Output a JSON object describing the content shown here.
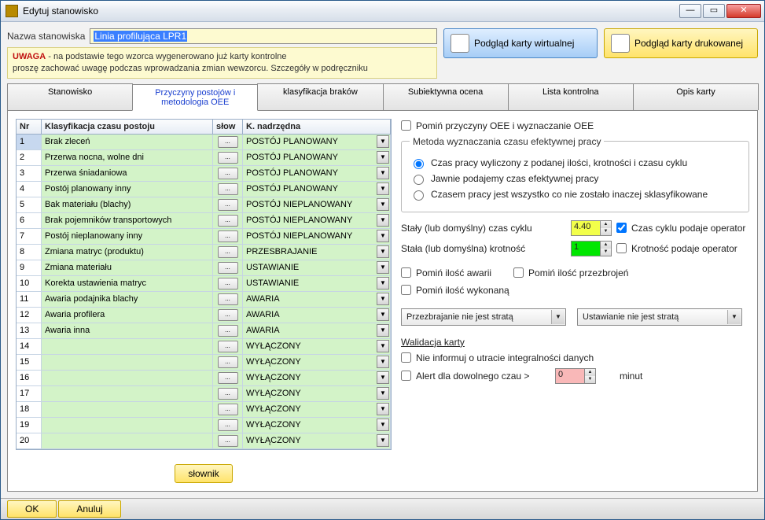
{
  "window": {
    "title": "Edytuj stanowisko"
  },
  "header": {
    "name_label": "Nazwa stanowiska",
    "name_value": "Linia profilująca LPR1",
    "warning_bold": "UWAGA",
    "warning_text": " - na podstawie tego wzorca wygenerowano już karty kontrolne\nproszę zachować uwagę podczas wprowadzania zmian wewzorcu. Szczegóły w podręczniku",
    "btn_virtual": "Podgląd karty wirtualnej",
    "btn_print": "Podgląd karty drukowanej"
  },
  "tabs": [
    "Stanowisko",
    "Przyczyny postojów i metodologia OEE",
    "klasyfikacja braków",
    "Subiektywna ocena",
    "Lista kontrolna",
    "Opis karty"
  ],
  "active_tab": 1,
  "grid": {
    "headers": {
      "nr": "Nr",
      "klas": "Klasyfikacja czasu postoju",
      "slow": "słow",
      "knad": "K. nadrzędna"
    },
    "rows": [
      {
        "nr": "1",
        "klas": "Brak zleceń",
        "knad": "POSTÓJ PLANOWANY"
      },
      {
        "nr": "2",
        "klas": "Przerwa nocna, wolne dni",
        "knad": "POSTÓJ PLANOWANY"
      },
      {
        "nr": "3",
        "klas": "Przerwa śniadaniowa",
        "knad": "POSTÓJ PLANOWANY"
      },
      {
        "nr": "4",
        "klas": "Postój planowany inny",
        "knad": "POSTÓJ PLANOWANY"
      },
      {
        "nr": "5",
        "klas": "Bak materiału (blachy)",
        "knad": "POSTÓJ NIEPLANOWANY"
      },
      {
        "nr": "6",
        "klas": "Brak pojemników transportowych",
        "knad": "POSTÓJ NIEPLANOWANY"
      },
      {
        "nr": "7",
        "klas": "Postój nieplanowany inny",
        "knad": "POSTÓJ NIEPLANOWANY"
      },
      {
        "nr": "8",
        "klas": "Zmiana matryc (produktu)",
        "knad": "PRZESBRAJANIE"
      },
      {
        "nr": "9",
        "klas": "Zmiana materiału",
        "knad": "USTAWIANIE"
      },
      {
        "nr": "10",
        "klas": "Korekta ustawienia matryc",
        "knad": "USTAWIANIE"
      },
      {
        "nr": "11",
        "klas": "Awaria podajnika blachy",
        "knad": "AWARIA"
      },
      {
        "nr": "12",
        "klas": "Awaria profilera",
        "knad": "AWARIA"
      },
      {
        "nr": "13",
        "klas": "Awaria inna",
        "knad": "AWARIA"
      },
      {
        "nr": "14",
        "klas": "",
        "knad": "WYŁĄCZONY"
      },
      {
        "nr": "15",
        "klas": "",
        "knad": "WYŁĄCZONY"
      },
      {
        "nr": "16",
        "klas": "",
        "knad": "WYŁĄCZONY"
      },
      {
        "nr": "17",
        "klas": "",
        "knad": "WYŁĄCZONY"
      },
      {
        "nr": "18",
        "klas": "",
        "knad": "WYŁĄCZONY"
      },
      {
        "nr": "19",
        "klas": "",
        "knad": "WYŁĄCZONY"
      },
      {
        "nr": "20",
        "klas": "",
        "knad": "WYŁĄCZONY"
      }
    ],
    "slownik_btn": "słownik",
    "ellipsis": "..."
  },
  "right": {
    "skip_oee": "Pomiń przyczyny OEE i wyznaczanie OEE",
    "method_legend": "Metoda wyznaczania  czasu efektywnej pracy",
    "radios": [
      "Czas pracy wyliczony z podanej ilości, krotności i czasu cyklu",
      "Jawnie podajemy czas efektywnej pracy",
      "Czasem pracy jest wszystko co nie zostało inaczej sklasyfikowane"
    ],
    "cycle_label": "Stały  (lub domyślny) czas cyklu",
    "cycle_value": "4.40",
    "cycle_chk": "Czas cyklu podaje operator",
    "mult_label": "Stała  (lub domyślna) krotność",
    "mult_value": "1",
    "mult_chk": "Krotność podaje operator",
    "skip_fail": "Pomiń ilość awarii",
    "skip_change": "Pomiń ilość przezbrojeń",
    "skip_done": "Pomiń ilość wykonaną",
    "select1": "Przezbrajanie nie jest stratą",
    "select2": "Ustawianie nie jest stratą",
    "valid_head": "Walidacja karty",
    "valid1": "Nie informuj o utracie integralności danych",
    "valid2_a": "Alert dla dowolnego czau >",
    "valid2_val": "0",
    "valid2_b": "minut"
  },
  "footer": {
    "ok": "OK",
    "cancel": "Anuluj"
  }
}
